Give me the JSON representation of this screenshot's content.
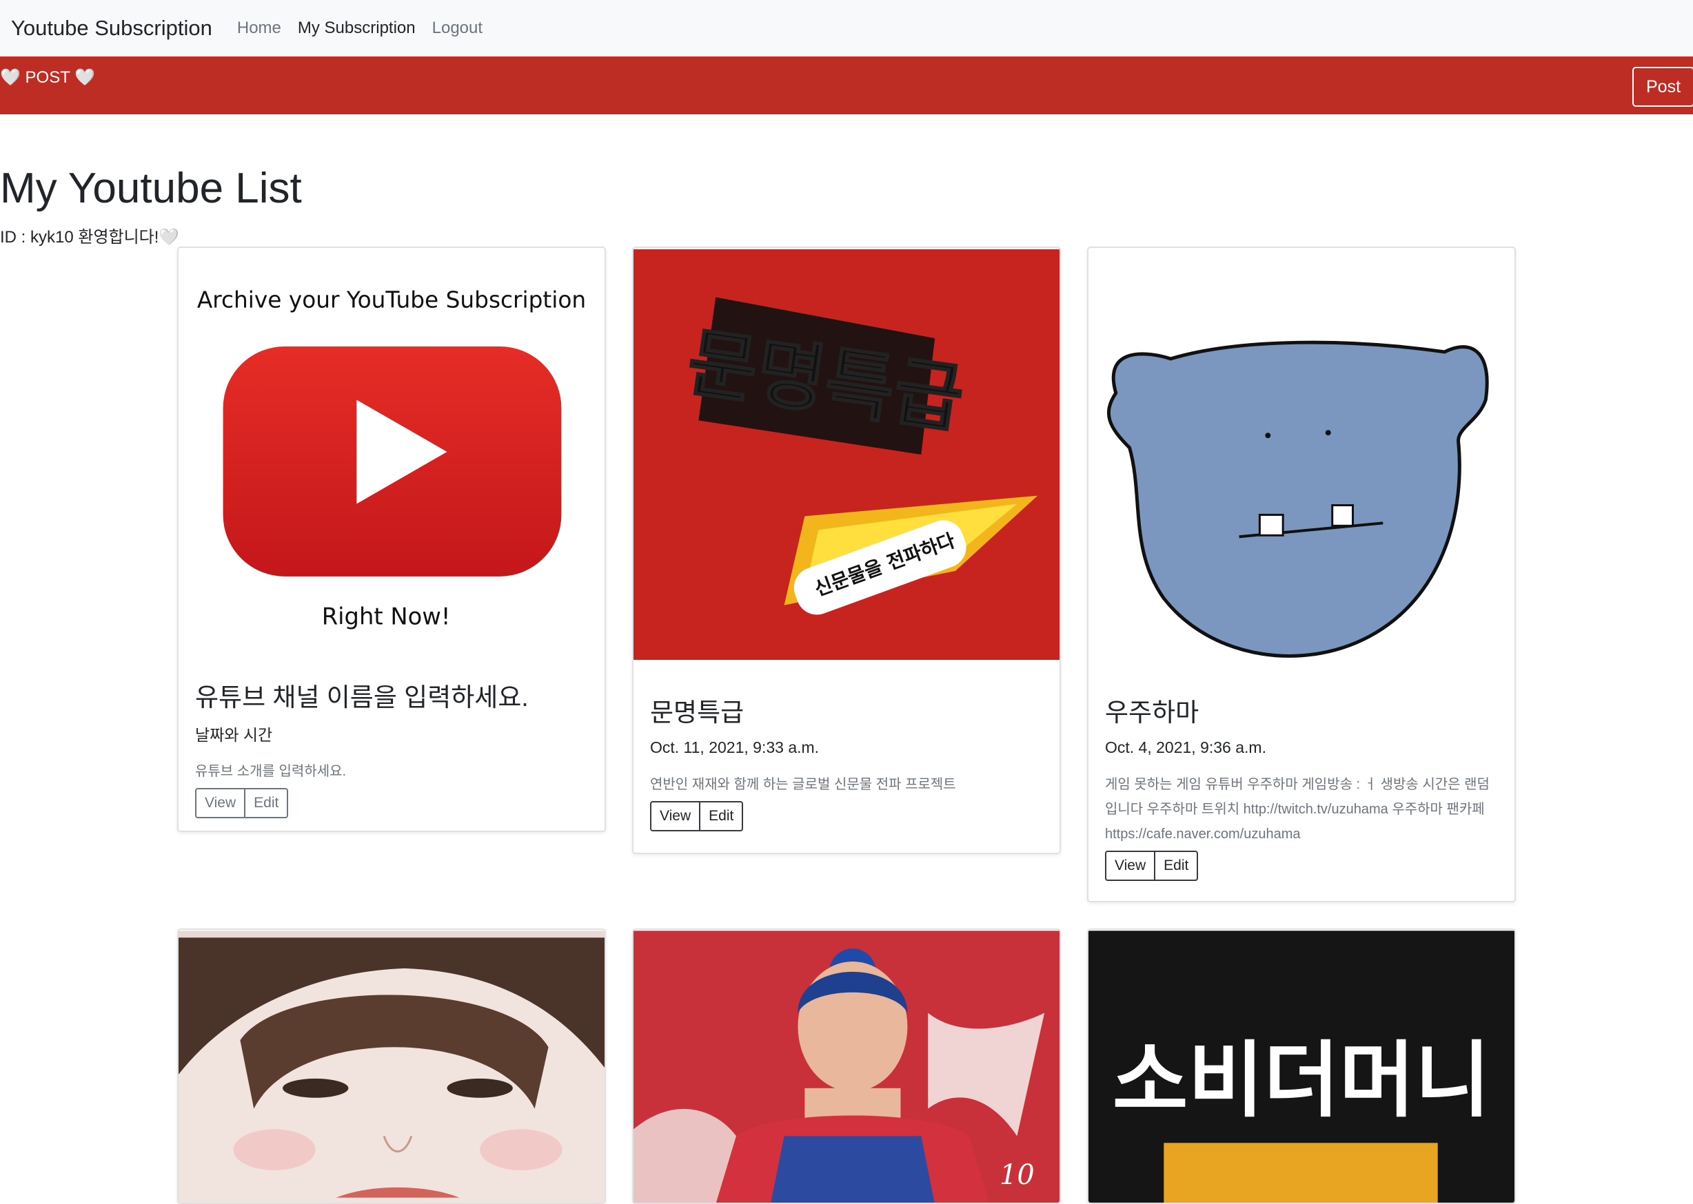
{
  "navbar": {
    "brand": "Youtube Subscription",
    "links": [
      "Home",
      "My Subscription",
      "Logout"
    ]
  },
  "postbar": {
    "title": "🤍 POST 🤍",
    "button": "Post"
  },
  "page": {
    "title": "My Youtube List",
    "welcome": "ID : kyk10 환영합니다!🤍"
  },
  "cards": [
    {
      "image_heading": "Archive your YouTube Subscription",
      "image_footer": "Right Now!",
      "title": "유튜브 채널 이름을 입력하세요.",
      "date": "날짜와 시간",
      "text": "유튜브 소개를 입력하세요.",
      "view": "View",
      "edit": "Edit"
    },
    {
      "image_text": "문명특급",
      "image_subtext": "신문물을 전파하다",
      "title": "문명특급",
      "date": "Oct. 11, 2021, 9:33 a.m.",
      "text": "연반인 재재와 함께 하는 글로벌 신문물 전파 프로젝트",
      "view": "View",
      "edit": "Edit"
    },
    {
      "title": "우주하마",
      "date": "Oct. 4, 2021, 9:36 a.m.",
      "text": "게임 못하는 게임 유튜버 우주하마 게임방송 : ㅓ 생방송 시간은 랜덤입니다 우주하마 트위치 http://twitch.tv/uzuhama 우주하마 팬카페 https://cafe.naver.com/uzuhama",
      "view": "View",
      "edit": "Edit"
    },
    {
      "image": "portrait-photo"
    },
    {
      "image": "volleyball-player-photo",
      "image_text": "10"
    },
    {
      "image_text": "소비더머니"
    }
  ],
  "colors": {
    "brand_red": "#bd2d23",
    "youtube_red": "#e62117",
    "navbar_bg": "#f8f9fa",
    "hippo_blue": "#7b97bf"
  }
}
